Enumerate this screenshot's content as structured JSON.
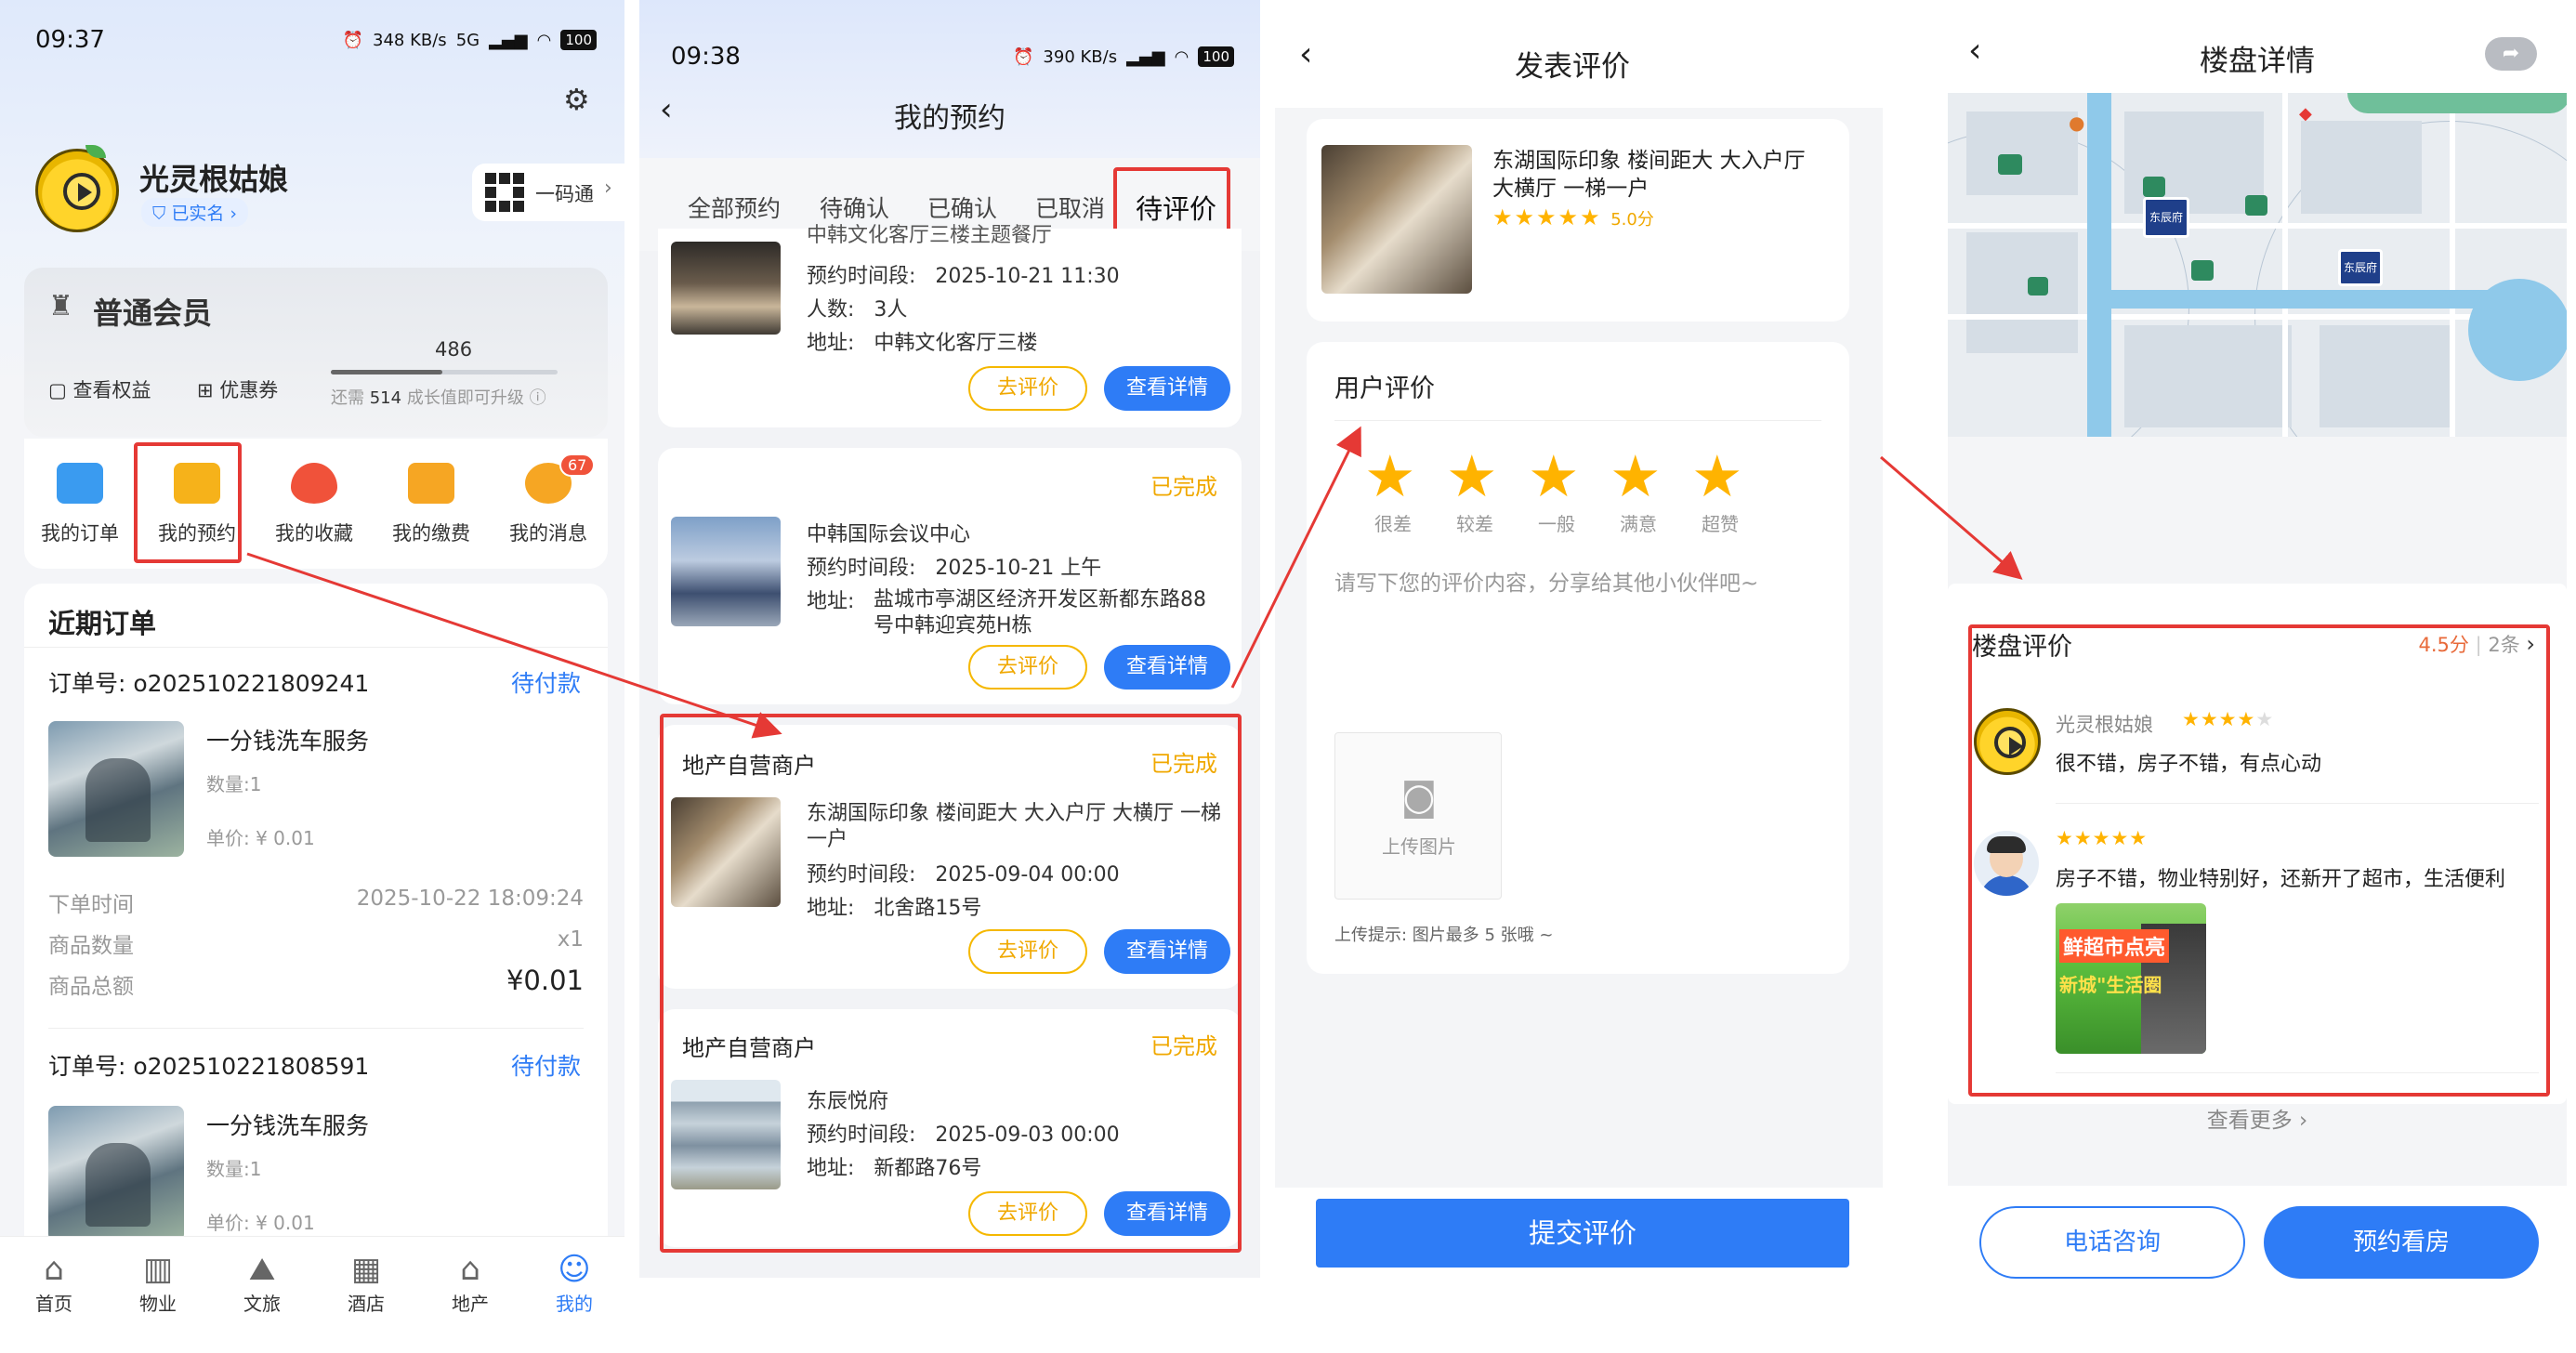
{
  "panel_profile": {
    "status": {
      "time": "09:37",
      "speed": "348 KB/s",
      "net1": "5G",
      "net2": "5G",
      "battery": "100"
    },
    "user": {
      "name": "光灵根姑娘",
      "verified": "已实名"
    },
    "qr": {
      "label": "一码通"
    },
    "member": {
      "level": "普通会员",
      "rights": "查看权益",
      "coupons": "优惠券",
      "growth_value": "486",
      "upgrade_prefix": "还需",
      "upgrade_amount": "514",
      "upgrade_suffix": "成长值即可升级"
    },
    "quick": [
      {
        "label": "我的订单",
        "color": "#3a9bf0"
      },
      {
        "label": "我的预约",
        "color": "#f6b21a"
      },
      {
        "label": "我的收藏",
        "color": "#f0523a"
      },
      {
        "label": "我的缴费",
        "color": "#f6a623"
      },
      {
        "label": "我的消息",
        "color": "#f6a623",
        "badge": "67"
      }
    ],
    "orders": {
      "title": "近期订单",
      "items": [
        {
          "no_label": "订单号:",
          "no": "o202510221809241",
          "status": "待付款",
          "name": "一分钱洗车服务",
          "qty": "数量:1",
          "price": "单价: ¥ 0.01",
          "time_label": "下单时间",
          "time": "2025-10-22 18:09:24",
          "count_label": "商品数量",
          "count": "x1",
          "total_label": "商品总额",
          "total": "¥0.01"
        },
        {
          "no_label": "订单号:",
          "no": "o202510221808591",
          "status": "待付款",
          "name": "一分钱洗车服务",
          "qty": "数量:1",
          "price": "单价: ¥ 0.01"
        }
      ]
    },
    "tabbar": [
      {
        "label": "首页",
        "icon": "home-icon",
        "glyph": "⌂"
      },
      {
        "label": "物业",
        "icon": "building-icon",
        "glyph": "▥"
      },
      {
        "label": "文旅",
        "icon": "mountain-icon",
        "glyph": "⛰"
      },
      {
        "label": "酒店",
        "icon": "hotel-icon",
        "glyph": "▦"
      },
      {
        "label": "地产",
        "icon": "estate-icon",
        "glyph": "⌂"
      },
      {
        "label": "我的",
        "icon": "user-icon",
        "glyph": "☺"
      }
    ]
  },
  "panel_bookings": {
    "status": {
      "time": "09:38",
      "speed": "390 KB/s",
      "battery": "100"
    },
    "title": "我的预约",
    "tabs": [
      "全部预约",
      "待确认",
      "已确认",
      "已取消",
      "待评价"
    ],
    "active_tab": "待评价",
    "cards": [
      {
        "partial_name": "中韩文化客厅三楼主题餐厅",
        "time_label": "预约时间段:",
        "time": "2025-10-21 11:30",
        "people_label": "人数:",
        "people": "3人",
        "addr_label": "地址:",
        "addr": "中韩文化客厅三楼"
      },
      {
        "status": "已完成",
        "name": "中韩国际会议中心",
        "time_label": "预约时间段:",
        "time": "2025-10-21 上午",
        "addr_label": "地址:",
        "addr1": "盐城市亭湖区经济开发区新都东路88",
        "addr2": "号中韩迎宾苑H栋"
      },
      {
        "merchant": "地产自营商户",
        "status": "已完成",
        "name1": "东湖国际印象 楼间距大 大入户厅 大横厅 一梯",
        "name2": "一户",
        "time_label": "预约时间段:",
        "time": "2025-09-04 00:00",
        "addr_label": "地址:",
        "addr": "北舍路15号"
      },
      {
        "merchant": "地产自营商户",
        "status": "已完成",
        "name": "东辰悦府",
        "time_label": "预约时间段:",
        "time": "2025-09-03 00:00",
        "addr_label": "地址:",
        "addr": "新都路76号"
      }
    ],
    "btn_review": "去评价",
    "btn_detail": "查看详情"
  },
  "panel_review": {
    "title": "发表评价",
    "product": {
      "name1": "东湖国际印象 楼间距大 大入户厅",
      "name2": "大横厅 一梯一户",
      "score": "5.0分",
      "rating": 5
    },
    "section": "用户评价",
    "levels": [
      "很差",
      "较差",
      "一般",
      "满意",
      "超赞"
    ],
    "placeholder": "请写下您的评价内容，分享给其他小伙伴吧~",
    "upload": "上传图片",
    "hint": "上传提示: 图片最多 5 张哦 ~",
    "submit": "提交评价"
  },
  "panel_detail": {
    "title": "楼盘详情",
    "map_labels": {
      "pin": "东辰府",
      "pin2": "东辰府"
    },
    "reviews_title": "楼盘评价",
    "score": "4.5分",
    "count": "2条",
    "reviews": [
      {
        "user": "光灵根姑娘",
        "rating": 4,
        "text": "很不错，房子不错，有点心动"
      },
      {
        "user": "",
        "rating": 5,
        "text": "房子不错，物业特别好，还新开了超市，生活便利",
        "img_line1": "鲜超市点亮",
        "img_line2": "新城\"生活圈"
      }
    ],
    "more": "查看更多",
    "btn_call": "电话咨询",
    "btn_book": "预约看房"
  },
  "colors": {
    "primary": "#2e7cf6",
    "accent": "#f0a800",
    "annotation": "#e53935",
    "star": "#ffb300"
  }
}
